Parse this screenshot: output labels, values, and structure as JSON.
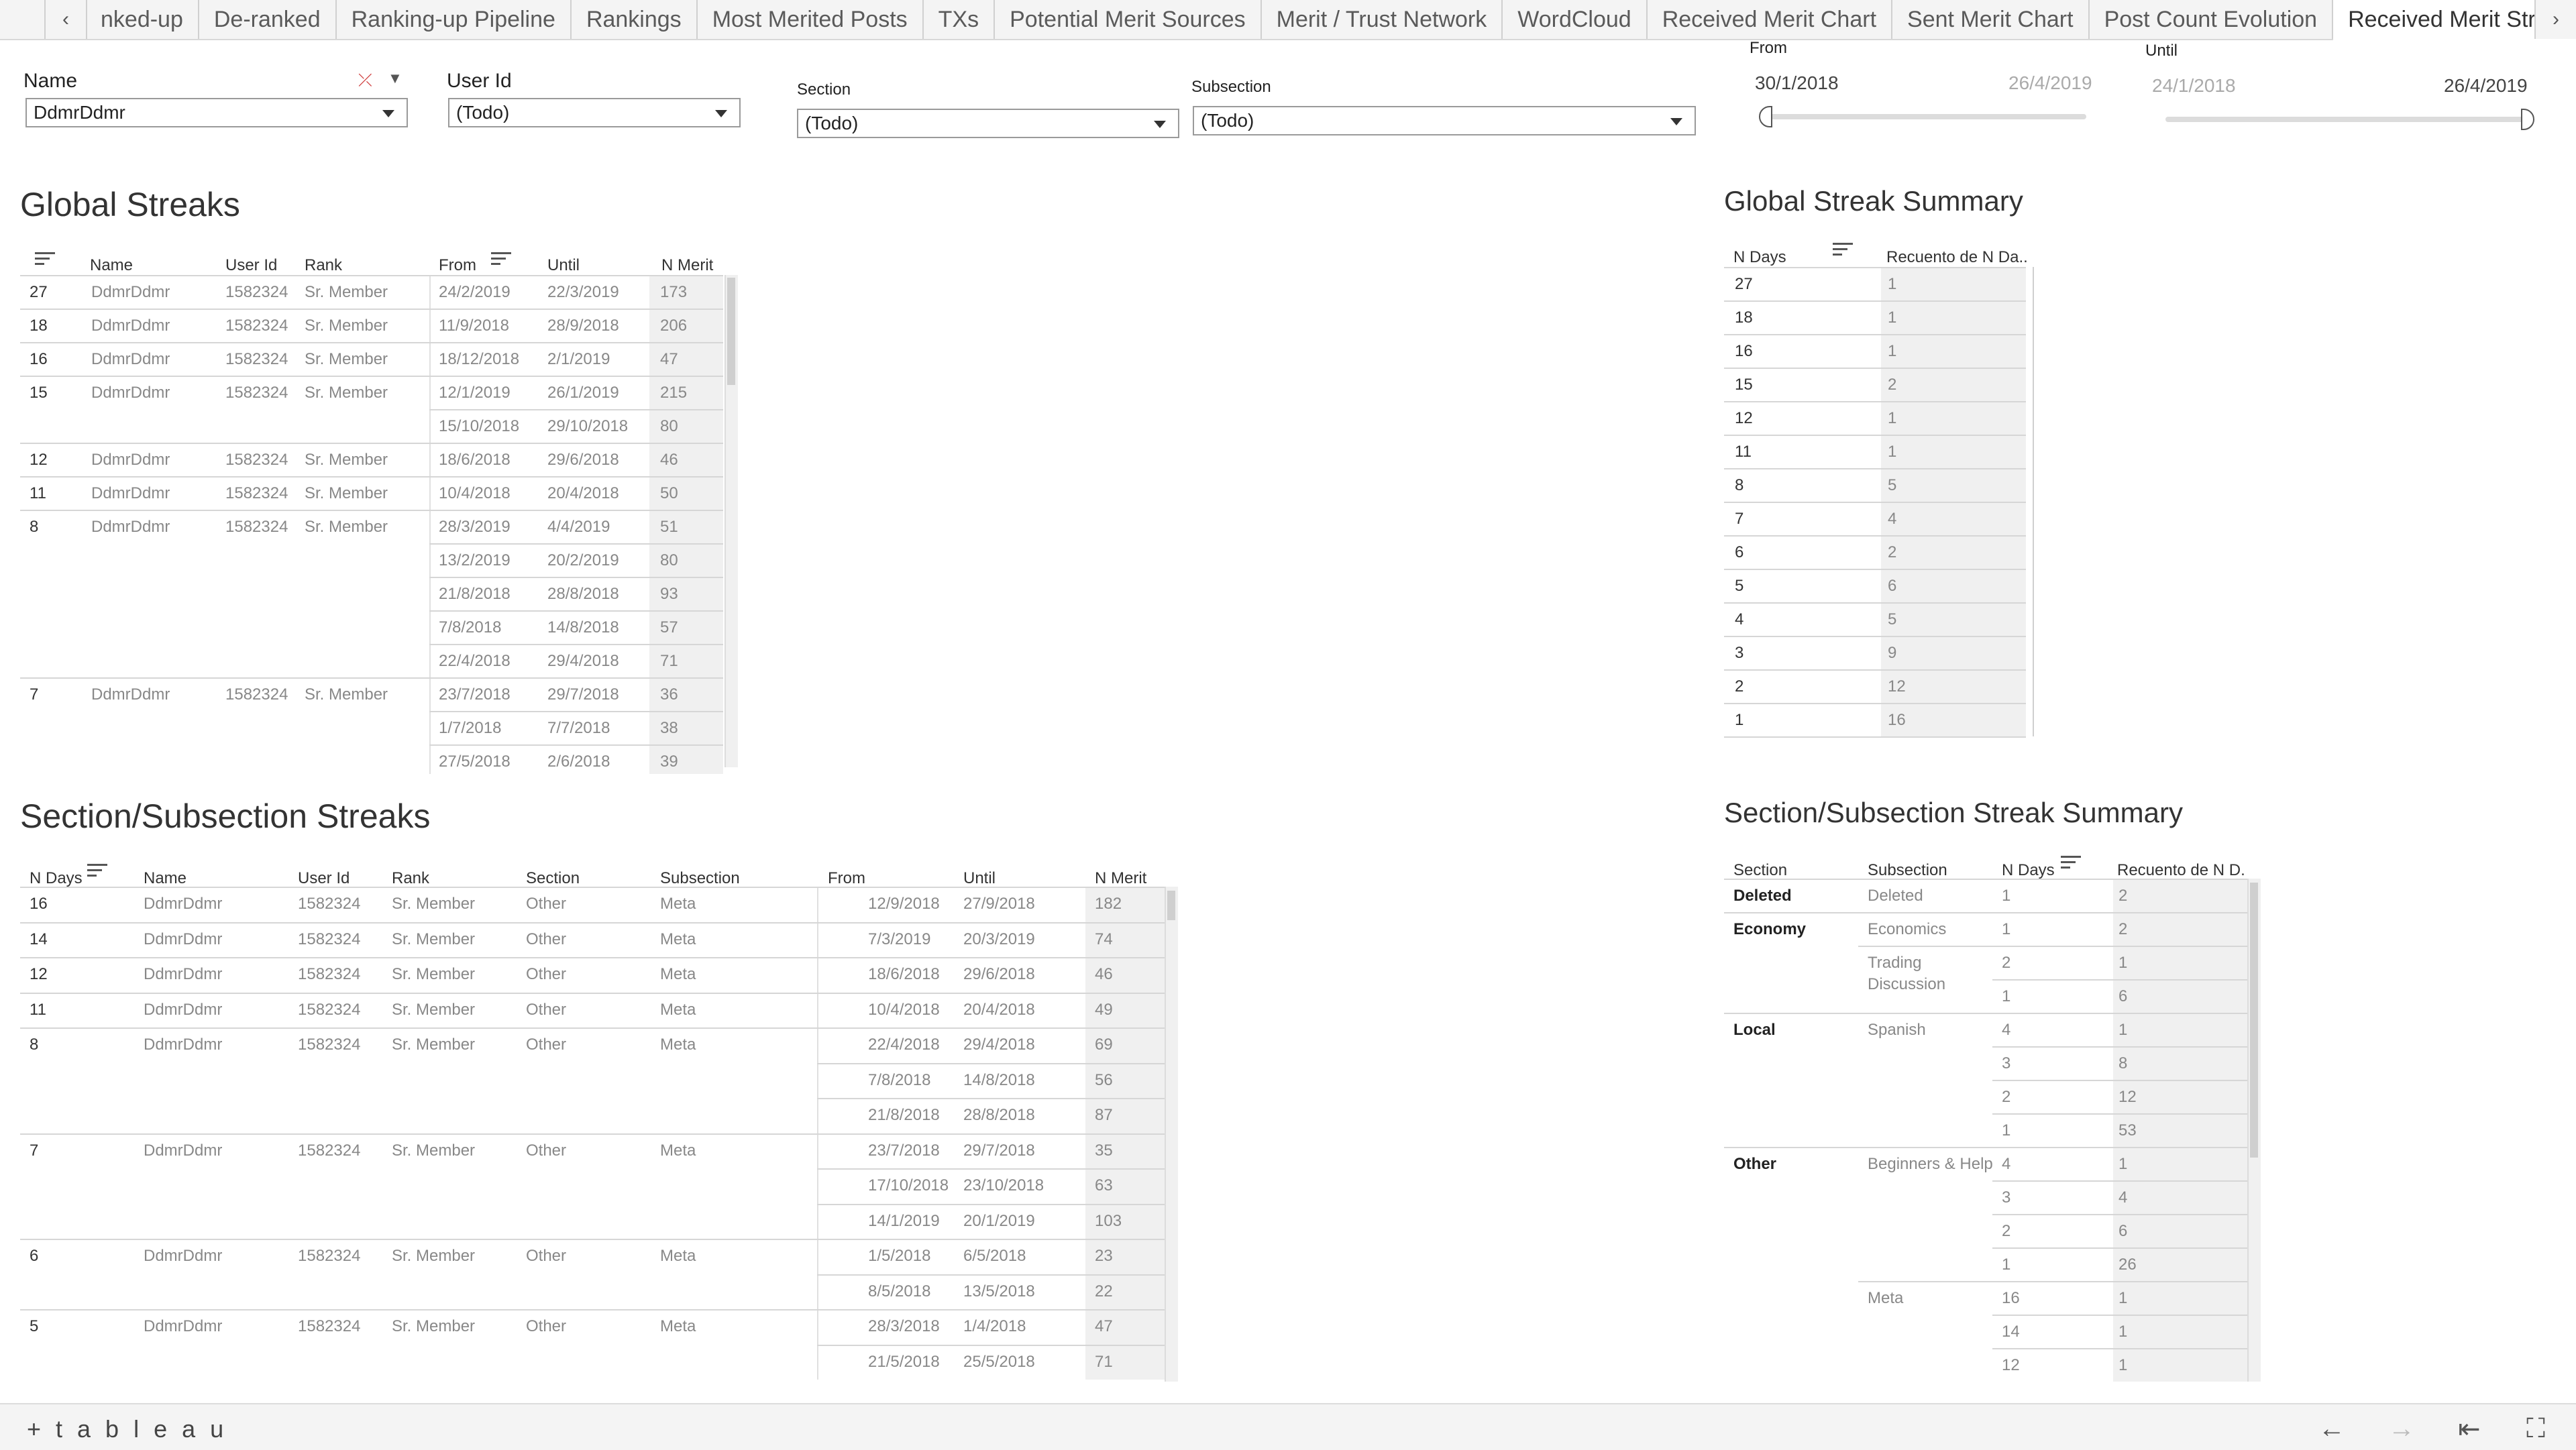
{
  "tabs": {
    "items": [
      "nked-up",
      "De-ranked",
      "Ranking-up Pipeline",
      "Rankings",
      "Most Merited Posts",
      "TXs",
      "Potential Merit Sources",
      "Merit / Trust Network",
      "WordCloud",
      "Received Merit Chart",
      "Sent Merit Chart",
      "Post Count Evolution",
      "Received Merit Streaks"
    ],
    "active": "Received Merit Streaks"
  },
  "filters": {
    "name": {
      "label": "Name",
      "value": "DdmrDdmr"
    },
    "user_id": {
      "label": "User Id",
      "value": "(Todo)"
    },
    "section": {
      "label": "Section",
      "value": "(Todo)"
    },
    "subsection": {
      "label": "Subsection",
      "value": "(Todo)"
    },
    "from": {
      "label": "From",
      "start": "30/1/2018",
      "end": "26/4/2019"
    },
    "until": {
      "label": "Until",
      "start": "24/1/2018",
      "end": "26/4/2019"
    }
  },
  "global_streaks": {
    "title": "Global Streaks",
    "headers": {
      "name": "Name",
      "user_id": "User Id",
      "rank": "Rank",
      "from": "From",
      "until": "Until",
      "n_merit": "N Merit"
    },
    "rows": [
      {
        "days": "27",
        "name": "DdmrDdmr",
        "uid": "1582324",
        "rank": "Sr. Member",
        "from": "24/2/2019",
        "until": "22/3/2019",
        "merit": "173"
      },
      {
        "days": "18",
        "name": "DdmrDdmr",
        "uid": "1582324",
        "rank": "Sr. Member",
        "from": "11/9/2018",
        "until": "28/9/2018",
        "merit": "206"
      },
      {
        "days": "16",
        "name": "DdmrDdmr",
        "uid": "1582324",
        "rank": "Sr. Member",
        "from": "18/12/2018",
        "until": "2/1/2019",
        "merit": "47"
      },
      {
        "days": "15",
        "name": "DdmrDdmr",
        "uid": "1582324",
        "rank": "Sr. Member",
        "from": "12/1/2019",
        "until": "26/1/2019",
        "merit": "215"
      },
      {
        "days": "",
        "name": "",
        "uid": "",
        "rank": "",
        "from": "15/10/2018",
        "until": "29/10/2018",
        "merit": "80"
      },
      {
        "days": "12",
        "name": "DdmrDdmr",
        "uid": "1582324",
        "rank": "Sr. Member",
        "from": "18/6/2018",
        "until": "29/6/2018",
        "merit": "46"
      },
      {
        "days": "11",
        "name": "DdmrDdmr",
        "uid": "1582324",
        "rank": "Sr. Member",
        "from": "10/4/2018",
        "until": "20/4/2018",
        "merit": "50"
      },
      {
        "days": "8",
        "name": "DdmrDdmr",
        "uid": "1582324",
        "rank": "Sr. Member",
        "from": "28/3/2019",
        "until": "4/4/2019",
        "merit": "51"
      },
      {
        "days": "",
        "name": "",
        "uid": "",
        "rank": "",
        "from": "13/2/2019",
        "until": "20/2/2019",
        "merit": "80"
      },
      {
        "days": "",
        "name": "",
        "uid": "",
        "rank": "",
        "from": "21/8/2018",
        "until": "28/8/2018",
        "merit": "93"
      },
      {
        "days": "",
        "name": "",
        "uid": "",
        "rank": "",
        "from": "7/8/2018",
        "until": "14/8/2018",
        "merit": "57"
      },
      {
        "days": "",
        "name": "",
        "uid": "",
        "rank": "",
        "from": "22/4/2018",
        "until": "29/4/2018",
        "merit": "71"
      },
      {
        "days": "7",
        "name": "DdmrDdmr",
        "uid": "1582324",
        "rank": "Sr. Member",
        "from": "23/7/2018",
        "until": "29/7/2018",
        "merit": "36"
      },
      {
        "days": "",
        "name": "",
        "uid": "",
        "rank": "",
        "from": "1/7/2018",
        "until": "7/7/2018",
        "merit": "38"
      },
      {
        "days": "",
        "name": "",
        "uid": "",
        "rank": "",
        "from": "27/5/2018",
        "until": "2/6/2018",
        "merit": "39"
      }
    ]
  },
  "global_summary": {
    "title": "Global Streak Summary",
    "headers": {
      "days": "N Days",
      "count": "Recuento de N Da.."
    },
    "rows": [
      {
        "days": "27",
        "count": "1"
      },
      {
        "days": "18",
        "count": "1"
      },
      {
        "days": "16",
        "count": "1"
      },
      {
        "days": "15",
        "count": "2"
      },
      {
        "days": "12",
        "count": "1"
      },
      {
        "days": "11",
        "count": "1"
      },
      {
        "days": "8",
        "count": "5"
      },
      {
        "days": "7",
        "count": "4"
      },
      {
        "days": "6",
        "count": "2"
      },
      {
        "days": "5",
        "count": "6"
      },
      {
        "days": "4",
        "count": "5"
      },
      {
        "days": "3",
        "count": "9"
      },
      {
        "days": "2",
        "count": "12"
      },
      {
        "days": "1",
        "count": "16"
      }
    ]
  },
  "section_streaks": {
    "title": "Section/Subsection Streaks",
    "headers": {
      "days": "N Days",
      "name": "Name",
      "user_id": "User Id",
      "rank": "Rank",
      "section": "Section",
      "subsection": "Subsection",
      "from": "From",
      "until": "Until",
      "n_merit": "N Merit"
    },
    "rows": [
      {
        "days": "16",
        "name": "DdmrDdmr",
        "uid": "1582324",
        "rank": "Sr. Member",
        "section": "Other",
        "sub": "Meta",
        "from": "12/9/2018",
        "until": "27/9/2018",
        "merit": "182"
      },
      {
        "days": "14",
        "name": "DdmrDdmr",
        "uid": "1582324",
        "rank": "Sr. Member",
        "section": "Other",
        "sub": "Meta",
        "from": "7/3/2019",
        "until": "20/3/2019",
        "merit": "74"
      },
      {
        "days": "12",
        "name": "DdmrDdmr",
        "uid": "1582324",
        "rank": "Sr. Member",
        "section": "Other",
        "sub": "Meta",
        "from": "18/6/2018",
        "until": "29/6/2018",
        "merit": "46"
      },
      {
        "days": "11",
        "name": "DdmrDdmr",
        "uid": "1582324",
        "rank": "Sr. Member",
        "section": "Other",
        "sub": "Meta",
        "from": "10/4/2018",
        "until": "20/4/2018",
        "merit": "49"
      },
      {
        "days": "8",
        "name": "DdmrDdmr",
        "uid": "1582324",
        "rank": "Sr. Member",
        "section": "Other",
        "sub": "Meta",
        "from": "22/4/2018",
        "until": "29/4/2018",
        "merit": "69"
      },
      {
        "days": "",
        "name": "",
        "uid": "",
        "rank": "",
        "section": "",
        "sub": "",
        "from": "7/8/2018",
        "until": "14/8/2018",
        "merit": "56"
      },
      {
        "days": "",
        "name": "",
        "uid": "",
        "rank": "",
        "section": "",
        "sub": "",
        "from": "21/8/2018",
        "until": "28/8/2018",
        "merit": "87"
      },
      {
        "days": "7",
        "name": "DdmrDdmr",
        "uid": "1582324",
        "rank": "Sr. Member",
        "section": "Other",
        "sub": "Meta",
        "from": "23/7/2018",
        "until": "29/7/2018",
        "merit": "35"
      },
      {
        "days": "",
        "name": "",
        "uid": "",
        "rank": "",
        "section": "",
        "sub": "",
        "from": "17/10/2018",
        "until": "23/10/2018",
        "merit": "63"
      },
      {
        "days": "",
        "name": "",
        "uid": "",
        "rank": "",
        "section": "",
        "sub": "",
        "from": "14/1/2019",
        "until": "20/1/2019",
        "merit": "103"
      },
      {
        "days": "6",
        "name": "DdmrDdmr",
        "uid": "1582324",
        "rank": "Sr. Member",
        "section": "Other",
        "sub": "Meta",
        "from": "1/5/2018",
        "until": "6/5/2018",
        "merit": "23"
      },
      {
        "days": "",
        "name": "",
        "uid": "",
        "rank": "",
        "section": "",
        "sub": "",
        "from": "8/5/2018",
        "until": "13/5/2018",
        "merit": "22"
      },
      {
        "days": "5",
        "name": "DdmrDdmr",
        "uid": "1582324",
        "rank": "Sr. Member",
        "section": "Other",
        "sub": "Meta",
        "from": "28/3/2018",
        "until": "1/4/2018",
        "merit": "47"
      },
      {
        "days": "",
        "name": "",
        "uid": "",
        "rank": "",
        "section": "",
        "sub": "",
        "from": "21/5/2018",
        "until": "25/5/2018",
        "merit": "71"
      }
    ]
  },
  "section_summary": {
    "title": "Section/Subsection Streak Summary",
    "headers": {
      "section": "Section",
      "subsection": "Subsection",
      "days": "N Days",
      "count": "Recuento de N D."
    },
    "rows": [
      {
        "section": "Deleted",
        "sub": "Deleted",
        "days": "1",
        "count": "2"
      },
      {
        "section": "Economy",
        "sub": "Economics",
        "days": "1",
        "count": "2"
      },
      {
        "section": "",
        "sub": "Trading",
        "days": "2",
        "count": "1"
      },
      {
        "section": "",
        "sub": "",
        "days": "1",
        "count": "6"
      },
      {
        "section": "Local",
        "sub": "Spanish",
        "days": "4",
        "count": "1"
      },
      {
        "section": "",
        "sub": "",
        "days": "3",
        "count": "8"
      },
      {
        "section": "",
        "sub": "",
        "days": "2",
        "count": "12"
      },
      {
        "section": "",
        "sub": "",
        "days": "1",
        "count": "53"
      },
      {
        "section": "Other",
        "sub": "Beginners & Help",
        "days": "4",
        "count": "1"
      },
      {
        "section": "",
        "sub": "",
        "days": "3",
        "count": "4"
      },
      {
        "section": "",
        "sub": "",
        "days": "2",
        "count": "6"
      },
      {
        "section": "",
        "sub": "",
        "days": "1",
        "count": "26"
      },
      {
        "section": "",
        "sub": "Meta",
        "days": "16",
        "count": "1"
      },
      {
        "section": "",
        "sub": "",
        "days": "14",
        "count": "1"
      },
      {
        "section": "",
        "sub": "",
        "days": "12",
        "count": "1"
      }
    ],
    "sub_extra": {
      "trading_line2": "Discussion"
    }
  },
  "footer": {
    "logo": "+ t a b l e a u"
  }
}
